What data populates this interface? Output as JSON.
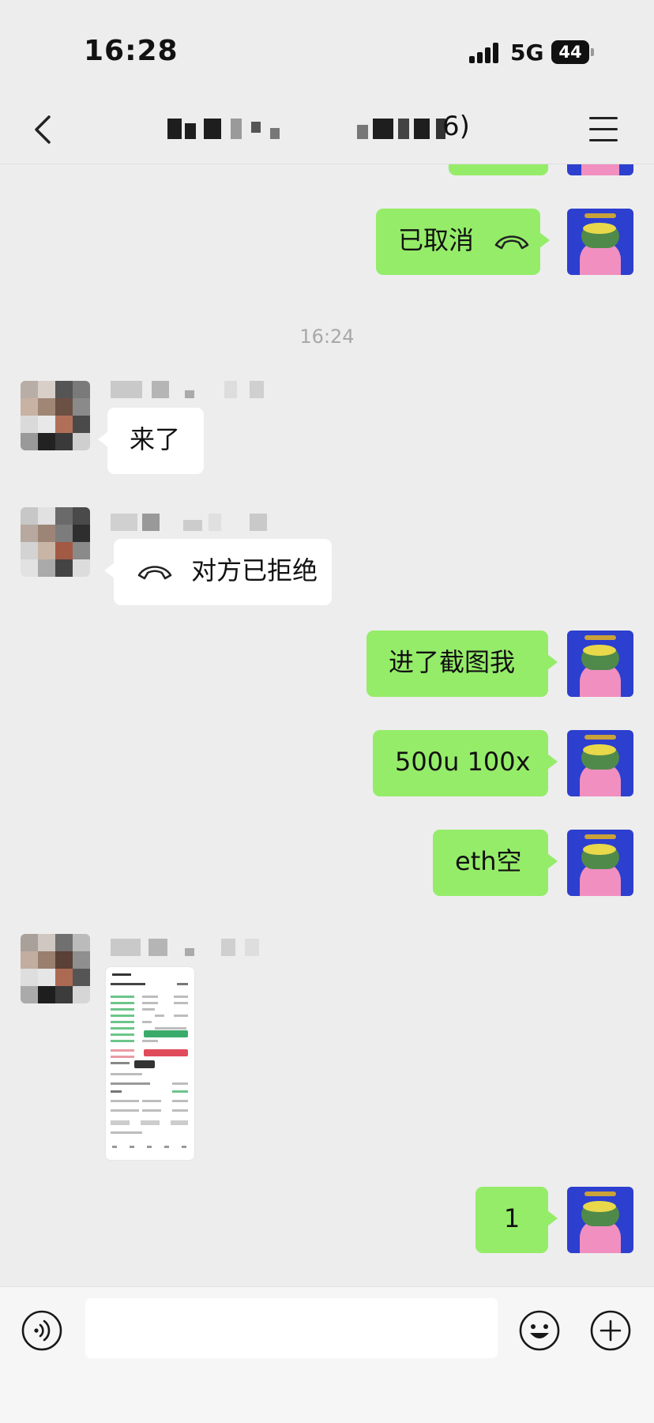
{
  "status_bar": {
    "time": "16:28",
    "network": "5G",
    "battery": "44"
  },
  "header": {
    "title_suffix": "6)"
  },
  "messages": {
    "m1": {
      "text": "已取消"
    },
    "ts1": "16:24",
    "m2": {
      "text": "来了"
    },
    "m3": {
      "text": "对方已拒绝"
    },
    "m4": {
      "text": "进了截图我"
    },
    "m5": {
      "text": "500u 100x"
    },
    "m6": {
      "text": "eth空"
    },
    "m8": {
      "text": "1"
    }
  },
  "input": {
    "value": "",
    "placeholder": ""
  },
  "colors": {
    "my_bubble": "#95ec69",
    "their_bubble": "#ffffff",
    "background": "#ededed",
    "my_avatar": "#2c3fcf"
  },
  "icons": {
    "back": "chevron-left-icon",
    "menu": "menu-icon",
    "call": "phone-hangup-icon",
    "voice": "voice-icon",
    "emoji": "emoji-icon",
    "plus": "plus-icon"
  }
}
